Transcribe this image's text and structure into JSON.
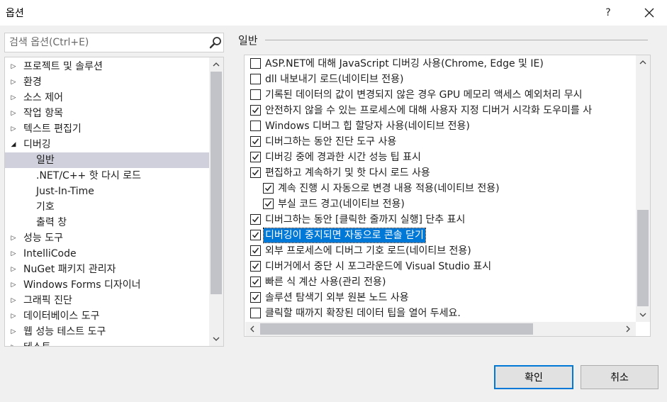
{
  "dialog": {
    "title": "옵션",
    "help_label": "?"
  },
  "search": {
    "placeholder": "검색 옵션(Ctrl+E)"
  },
  "tree": {
    "items": [
      {
        "label": "프로젝트 및 솔루션",
        "arrow": "▷",
        "level": 0
      },
      {
        "label": "환경",
        "arrow": "▷",
        "level": 0
      },
      {
        "label": "소스 제어",
        "arrow": "▷",
        "level": 0
      },
      {
        "label": "작업 항목",
        "arrow": "▷",
        "level": 0
      },
      {
        "label": "텍스트 편집기",
        "arrow": "▷",
        "level": 0
      },
      {
        "label": "디버깅",
        "arrow": "◢",
        "level": 0
      },
      {
        "label": "일반",
        "arrow": "",
        "level": 1,
        "selected": true
      },
      {
        "label": ".NET/C++ 핫 다시 로드",
        "arrow": "",
        "level": 1
      },
      {
        "label": "Just-In-Time",
        "arrow": "",
        "level": 1
      },
      {
        "label": "기호",
        "arrow": "",
        "level": 1
      },
      {
        "label": "출력 창",
        "arrow": "",
        "level": 1
      },
      {
        "label": "성능 도구",
        "arrow": "▷",
        "level": 0
      },
      {
        "label": "IntelliCode",
        "arrow": "▷",
        "level": 0
      },
      {
        "label": "NuGet 패키지 관리자",
        "arrow": "▷",
        "level": 0
      },
      {
        "label": "Windows Forms 디자이너",
        "arrow": "▷",
        "level": 0
      },
      {
        "label": "그래픽 진단",
        "arrow": "▷",
        "level": 0
      },
      {
        "label": "데이터베이스 도구",
        "arrow": "▷",
        "level": 0
      },
      {
        "label": "웹 성능 테스트 도구",
        "arrow": "▷",
        "level": 0
      },
      {
        "label": "테스트",
        "arrow": "▷",
        "level": 0
      }
    ]
  },
  "section": {
    "title": "일반"
  },
  "options": [
    {
      "label": "ASP.NET에 대해 JavaScript 디버깅 사용(Chrome, Edge 및 IE)",
      "checked": false,
      "indent": 0
    },
    {
      "label": "dll 내보내기 로드(네이티브 전용)",
      "checked": false,
      "indent": 0
    },
    {
      "label": "기록된 데이터의 값이 변경되지 않은 경우 GPU 메모리 액세스 예외처리 무시",
      "checked": false,
      "indent": 0
    },
    {
      "label": "안전하지 않을 수 있는 프로세스에 대해 사용자 지정 디버거 시각화 도우미를 사",
      "checked": true,
      "indent": 0
    },
    {
      "label": "Windows 디버그 힙 할당자 사용(네이티브 전용)",
      "checked": false,
      "indent": 0
    },
    {
      "label": "디버그하는 동안 진단 도구 사용",
      "checked": true,
      "indent": 0
    },
    {
      "label": "디버깅 중에 경과한 시간 성능 팁 표시",
      "checked": true,
      "indent": 0
    },
    {
      "label": "편집하고 계속하기 및 핫 다시 로드 사용",
      "checked": true,
      "indent": 0
    },
    {
      "label": "계속 진행 시 자동으로 변경 내용 적용(네이티브 전용)",
      "checked": true,
      "indent": 1
    },
    {
      "label": "부실 코드 경고(네이티브 전용)",
      "checked": true,
      "indent": 1
    },
    {
      "label": "디버그하는 동안 [클릭한 줄까지 실행] 단추 표시",
      "checked": true,
      "indent": 0
    },
    {
      "label": "디버깅이 중지되면 자동으로 콘솔 닫기",
      "checked": true,
      "indent": 0,
      "highlighted": true
    },
    {
      "label": "외부 프로세스에 디버그 기호 로드(네이티브 전용)",
      "checked": true,
      "indent": 0
    },
    {
      "label": "디버거에서 중단 시 포그라운드에 Visual Studio 표시",
      "checked": true,
      "indent": 0
    },
    {
      "label": "빠른 식 계산 사용(관리 전용)",
      "checked": true,
      "indent": 0
    },
    {
      "label": "솔루션 탐색기 외부 원본 노드 사용",
      "checked": true,
      "indent": 0
    },
    {
      "label": "클릭할 때까지 확장된 데이터 팁을 열어 두세요.",
      "checked": false,
      "indent": 0
    }
  ],
  "buttons": {
    "ok": "확인",
    "cancel": "취소"
  },
  "colors": {
    "accent": "#0078d7",
    "selection": "#cfd0dc"
  }
}
